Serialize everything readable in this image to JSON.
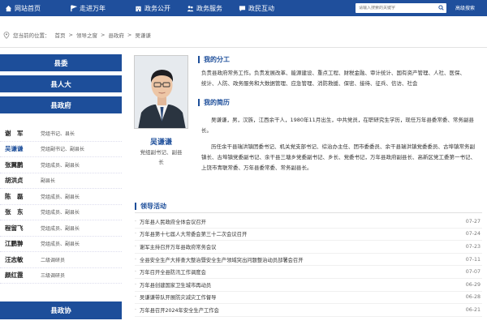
{
  "topnav": {
    "items": [
      {
        "label": "网站首页",
        "icon": "home-icon"
      },
      {
        "label": "走进万年",
        "icon": "flag-icon"
      },
      {
        "label": "政务公开",
        "icon": "building-icon"
      },
      {
        "label": "政务服务",
        "icon": "people-icon"
      },
      {
        "label": "政民互动",
        "icon": "chat-icon"
      }
    ],
    "search_placeholder": "请输入搜索的关键字",
    "advanced_search": "高级搜索",
    "color": "#1f4f9c"
  },
  "breadcrumb": {
    "prefix": "您当前的位置：",
    "items": [
      "首页",
      "领导之窗",
      "县政府",
      "吴谦谦"
    ],
    "separator": ">"
  },
  "sidebar": {
    "sections": [
      "县委",
      "县人大",
      "县政府"
    ],
    "people": [
      {
        "name": "谢　军",
        "position": "党组书记、县长"
      },
      {
        "name": "吴谦谦",
        "position": "党组副书记、副县长",
        "active": true
      },
      {
        "name": "张翼鹏",
        "position": "党组成员、副县长"
      },
      {
        "name": "胡洪贞",
        "position": "副县长"
      },
      {
        "name": "陈　磊",
        "position": "党组成员、副县长"
      },
      {
        "name": "张　东",
        "position": "党组成员、副县长"
      },
      {
        "name": "程留飞",
        "position": "党组成员、副县长"
      },
      {
        "name": "江鹏翀",
        "position": "党组成员、副县长"
      },
      {
        "name": "汪志敏",
        "position": "二级调研员"
      },
      {
        "name": "颜红霞",
        "position": "三级调研员"
      }
    ],
    "bottom_section": "县政协"
  },
  "profile": {
    "name": "吴谦谦",
    "title_line1": "党组副书记、副县",
    "title_line2": "长"
  },
  "duties": {
    "heading": "我的分工",
    "text": "负责县政府常务工作。负责发展改革、能源建设、重点工程、财税金融、审计统计、国有资产管理、人社、医保、统计、人防、政务服务和大数据管理、应急管理、消防救援、保密、接待、征兵、信访、社会"
  },
  "resume": {
    "heading": "我的简历",
    "para1": "吴谦谦，男，汉族，江西余干人，1980年11月出生，中共党员，在职研究生学历，现任万年县委常委、常务副县长。",
    "para2": "历任余干县瑞洪镇团委书记、机关党支部书记、综治办主任、团市委委员、余干县瑞洪镇党委委员、古埠镇常务副镇长、古埠镇党委副书记、余干县三塘乡党委副书记、乡长、党委书记，万年县政府副县长、高新区党工委第一书记、上饶市青联常委、万年县委常委、常务副县长。"
  },
  "activities": {
    "heading": "领导活动",
    "items": [
      {
        "title": "万年县人民政府全体会议召开",
        "date": "07-27"
      },
      {
        "title": "万年县第十七届人大常委会第三十二次会议召开",
        "date": "07-24"
      },
      {
        "title": "谢军主持召开万年县政府常务会议",
        "date": "07-23"
      },
      {
        "title": "全县安全生产大排查大整治暨安全生产领域突出问题整治动员部署会召开",
        "date": "07-11"
      },
      {
        "title": "万年召开全县防汛工作调度会",
        "date": "07-07"
      },
      {
        "title": "万年县创建国家卫生城市再动员",
        "date": "06-29"
      },
      {
        "title": "吴谦谦带队开展防灾减灾工作督导",
        "date": "06-28"
      },
      {
        "title": "万年县召开2024年安全生产工作会",
        "date": "06-21"
      }
    ]
  }
}
